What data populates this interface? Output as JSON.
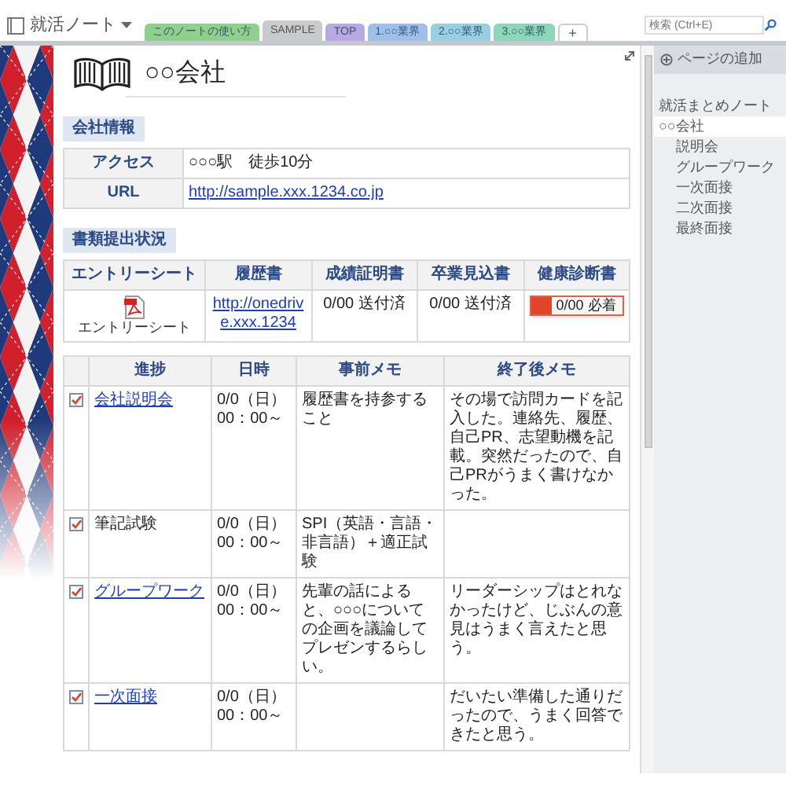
{
  "notebook": {
    "title": "就活ノート"
  },
  "tabs": [
    {
      "label": "このノートの使い方",
      "color": "#8fd08a",
      "selected": false
    },
    {
      "label": "SAMPLE",
      "color": "#c9cacc",
      "selected": true
    },
    {
      "label": "TOP",
      "color": "#b8a8e3",
      "selected": false
    },
    {
      "label": "1.○○業界",
      "color": "#9dc0ea",
      "selected": false
    },
    {
      "label": "2.○○業界",
      "color": "#97cfe3",
      "selected": false
    },
    {
      "label": "3.○○業界",
      "color": "#8dd6b9",
      "selected": false
    }
  ],
  "add_tab": "+",
  "search": {
    "placeholder": "検索 (Ctrl+E)"
  },
  "page": {
    "title": "○○会社"
  },
  "company_info": {
    "heading": "会社情報",
    "rows": [
      {
        "label": "アクセス",
        "value": "○○○駅　徒歩10分",
        "link": false
      },
      {
        "label": "URL",
        "value": "http://sample.xxx.1234.co.jp",
        "link": true
      }
    ]
  },
  "documents": {
    "heading": "書類提出状況",
    "columns": [
      "エントリーシート",
      "履歴書",
      "成績証明書",
      "卒業見込書",
      "健康診断書"
    ],
    "cells": [
      {
        "kind": "file",
        "text": "エントリーシート"
      },
      {
        "kind": "link",
        "text": "http://onedrive.xxx.1234"
      },
      {
        "kind": "text",
        "text": "0/00 送付済"
      },
      {
        "kind": "text",
        "text": "0/00 送付済"
      },
      {
        "kind": "meter",
        "text": "0/00 必着",
        "level": 0.23
      }
    ]
  },
  "progress": {
    "columns": [
      "進捗",
      "日時",
      "事前メモ",
      "終了後メモ"
    ],
    "rows": [
      {
        "checked": true,
        "step": "会社説明会",
        "link": true,
        "date": "0/0（日）",
        "time": "00：00～",
        "before": "履歴書を持参すること",
        "after": "その場で訪問カードを記入した。連絡先、履歴、自己PR、志望動機を記載。突然だったので、自己PRがうまく書けなかった。"
      },
      {
        "checked": true,
        "step": "筆記試験",
        "link": false,
        "date": "0/0（日）",
        "time": "00：00～",
        "before": "SPI（英語・言語・非言語）＋適正試験",
        "after": ""
      },
      {
        "checked": true,
        "step": "グループワーク",
        "link": true,
        "date": "0/0（日）",
        "time": "00：00～",
        "before": "先輩の話によると、○○○についての企画を議論してプレゼンするらしい。",
        "after": "リーダーシップはとれなかったけど、じぶんの意見はうまく言えたと思う。"
      },
      {
        "checked": true,
        "step": "一次面接",
        "link": true,
        "date": "0/0（日）",
        "time": "00：00～",
        "before": "",
        "after": "だいたい準備した通りだったので、うまく回答できたと思う。"
      }
    ]
  },
  "pages_pane": {
    "add_button": "ページの追加",
    "pages": [
      {
        "title": "就活まとめノート",
        "selected": false
      },
      {
        "title": "○○会社",
        "selected": true,
        "children": [
          {
            "title": "説明会",
            "selected": false
          },
          {
            "title": "グループワーク",
            "selected": false
          },
          {
            "title": "一次面接",
            "selected": false
          },
          {
            "title": "二次面接",
            "selected": false
          },
          {
            "title": "最終面接",
            "selected": false
          }
        ]
      }
    ]
  }
}
